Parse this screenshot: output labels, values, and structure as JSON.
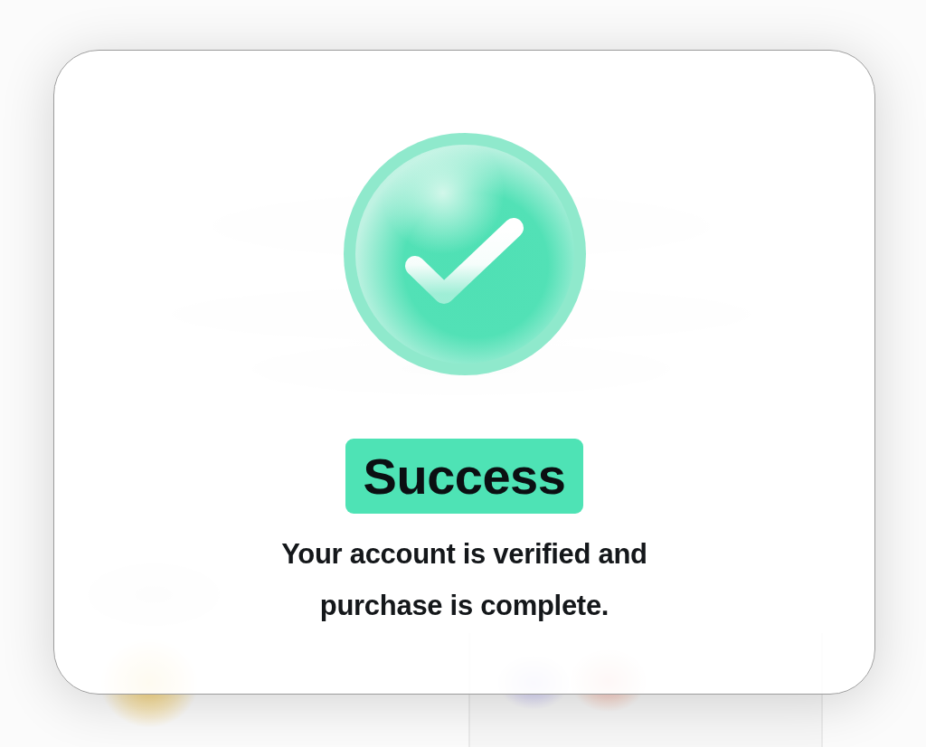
{
  "dialog": {
    "title": "Success",
    "message": "Your account is verified and purchase is complete."
  }
}
